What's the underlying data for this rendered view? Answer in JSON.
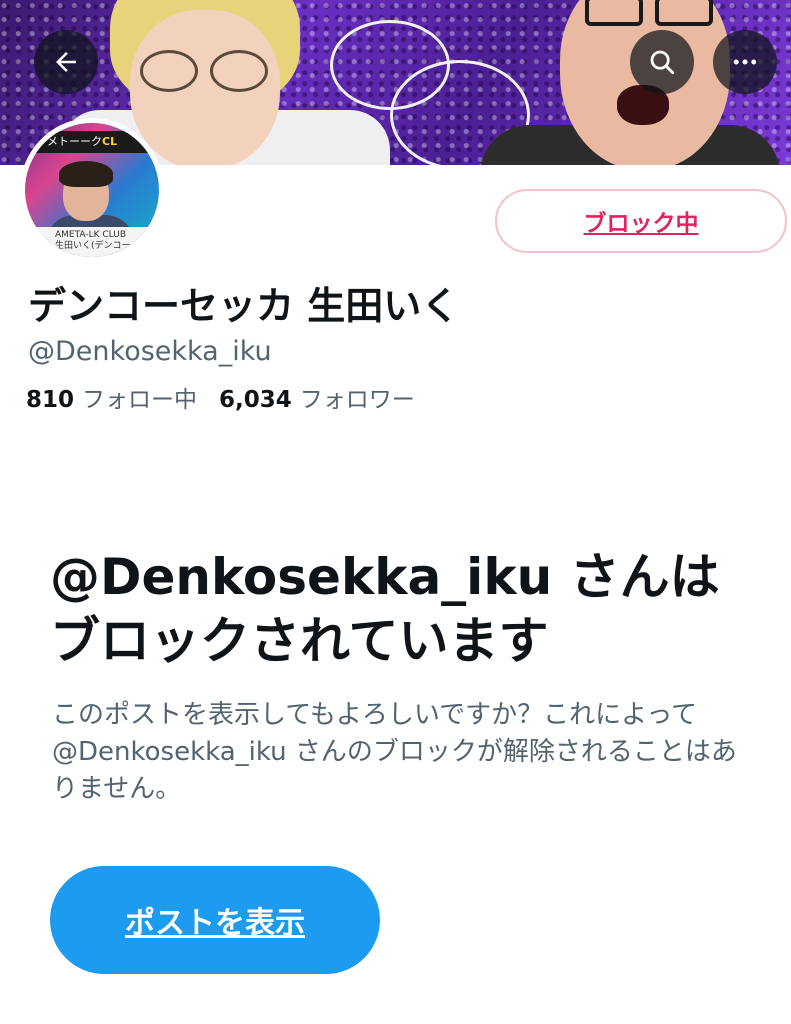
{
  "header": {
    "back_icon": "arrow-left-icon",
    "search_icon": "search-icon",
    "more_icon": "more-horizontal-icon"
  },
  "avatar": {
    "ticker_text": "メトーーク",
    "ticker_badge": "CL",
    "lower_line1": "AMETA-LK CLUB",
    "lower_line2": "生田いく(デンコー"
  },
  "profile": {
    "block_button_label": "ブロック中",
    "display_name": "デンコーセッカ 生田いく",
    "handle": "@Denkosekka_iku",
    "following_count": "810",
    "following_label": "フォロー中",
    "followers_count": "6,034",
    "followers_label": "フォロワー"
  },
  "blocked_notice": {
    "heading": "@Denkosekka_iku さんはブロックされています",
    "description": "このポストを表示してもよろしいですか？これによって @Denkosekka_iku さんのブロックが解除されることはありません。",
    "show_button_label": "ポストを表示"
  },
  "colors": {
    "accent": "#1d9bf0",
    "blocked_red": "#e0245e",
    "secondary_text": "#536471"
  }
}
